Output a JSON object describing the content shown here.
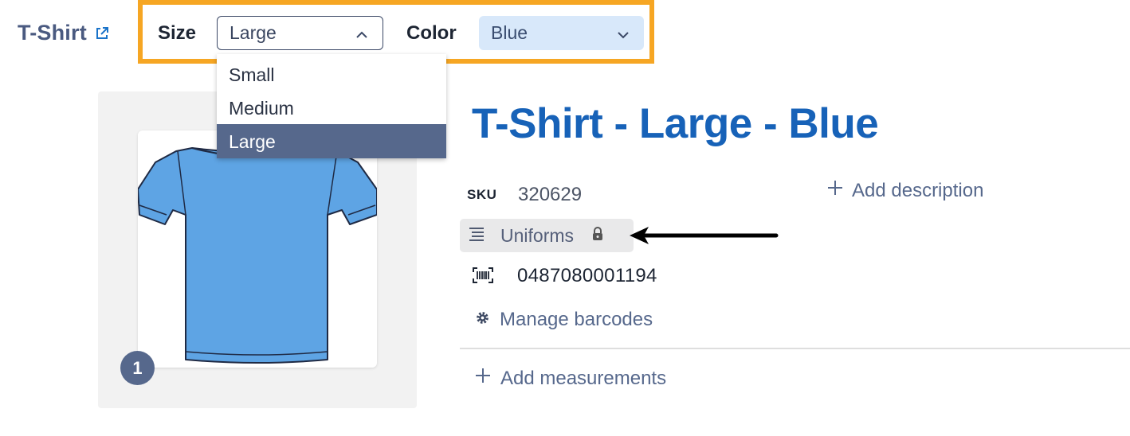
{
  "product": {
    "name": "T-Shirt"
  },
  "variant_selector": {
    "size_label": "Size",
    "size_value": "Large",
    "color_label": "Color",
    "color_value": "Blue",
    "size_options": [
      "Small",
      "Medium",
      "Large"
    ],
    "highlight_color": "#f6a623"
  },
  "image": {
    "count": "1"
  },
  "title": "T-Shirt - Large - Blue",
  "details": {
    "sku_label": "SKU",
    "sku_value": "320629",
    "add_description": "Add description",
    "category": "Uniforms",
    "barcode": "0487080001194",
    "manage_barcodes": "Manage barcodes",
    "add_measurements": "Add measurements"
  },
  "icons": [
    "external-link-icon",
    "chevron-up-icon",
    "chevron-down-icon",
    "plus-icon",
    "category-icon",
    "lock-icon",
    "barcode-icon",
    "gear-icon",
    "arrow-left-icon"
  ],
  "colors": {
    "title": "#1762b8",
    "accent": "#56688c",
    "color_select_bg": "#d8e8fa",
    "shirt": "#5ea4e4"
  }
}
